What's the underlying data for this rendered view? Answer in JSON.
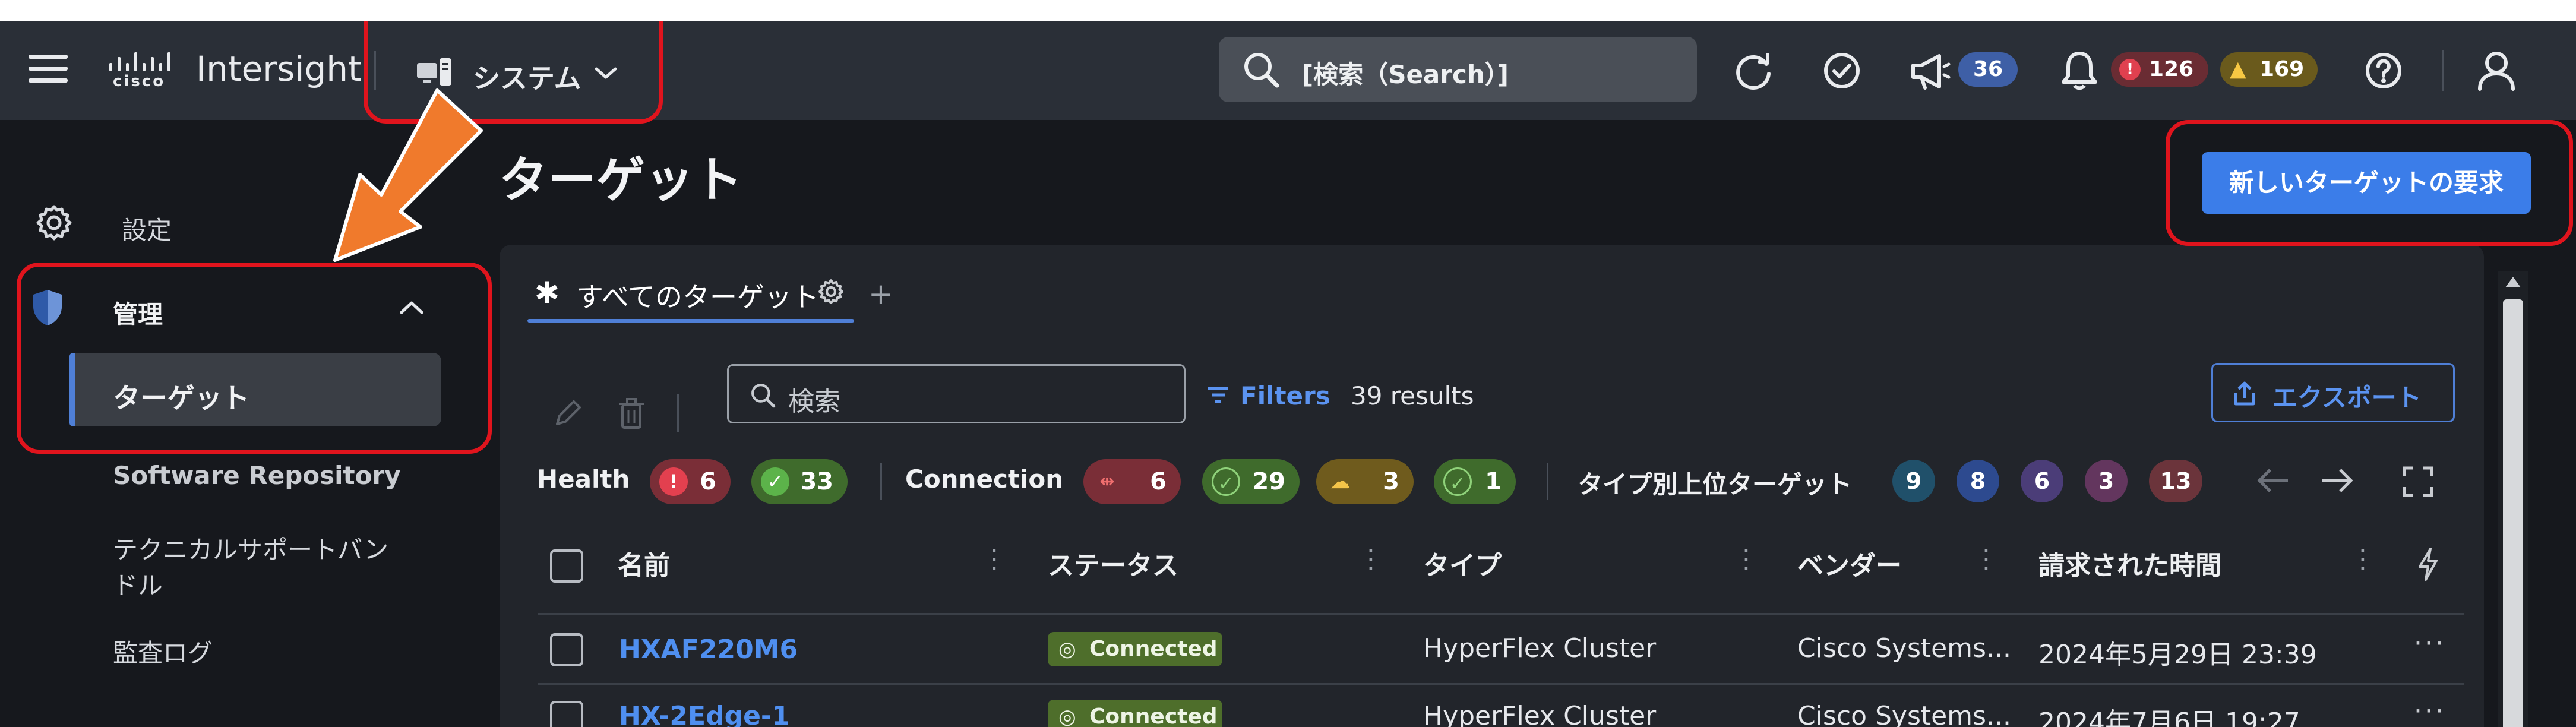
{
  "header": {
    "app_name": "Intersight",
    "cisco_text": "cisco",
    "system_menu": "システム",
    "search_placeholder": "[検索（Search）]",
    "announcements_count": "36",
    "alarms_critical_count": "126",
    "alarms_warning_count": "169"
  },
  "sidebar": {
    "settings": "設定",
    "admin_group": "管理",
    "items": [
      {
        "label": "ターゲット"
      },
      {
        "label": "Software Repository"
      },
      {
        "label": "テクニカルサポートバン"
      },
      {
        "label": "ドル"
      },
      {
        "label": "監査ログ"
      }
    ]
  },
  "main": {
    "page_title": "ターゲット",
    "new_target_button": "新しいターゲットの要求",
    "tab_all_targets": "すべてのターゲット",
    "search_placeholder": "検索",
    "filters_label": "Filters",
    "results_text": "39 results",
    "export_label": "エクスポート",
    "health_label": "Health",
    "health_critical": "6",
    "health_ok": "33",
    "connection_label": "Connection",
    "conn_disconnected": "6",
    "conn_connected": "29",
    "conn_cloud": "3",
    "conn_other": "1",
    "top_targets_label": "タイプ別上位ターゲット",
    "top_counts": [
      "9",
      "8",
      "6",
      "3",
      "13"
    ]
  },
  "table": {
    "columns": {
      "name": "名前",
      "status": "ステータス",
      "type": "タイプ",
      "vendor": "ベンダー",
      "claimed": "請求された時間"
    },
    "rows": [
      {
        "name": "HXAF220M6",
        "status": "Connected",
        "type": "HyperFlex Cluster",
        "vendor": "Cisco Systems...",
        "claimed": "2024年5月29日 23:39"
      },
      {
        "name": "HX-2Edge-1",
        "status": "Connected",
        "type": "HyperFlex Cluster",
        "vendor": "Cisco Systems...",
        "claimed": "2024年7月6日 19:27"
      }
    ]
  },
  "colors": {
    "accent": "#3b7de9",
    "annotation_red": "#e0141d",
    "annotation_arrow": "#f07a2c"
  }
}
